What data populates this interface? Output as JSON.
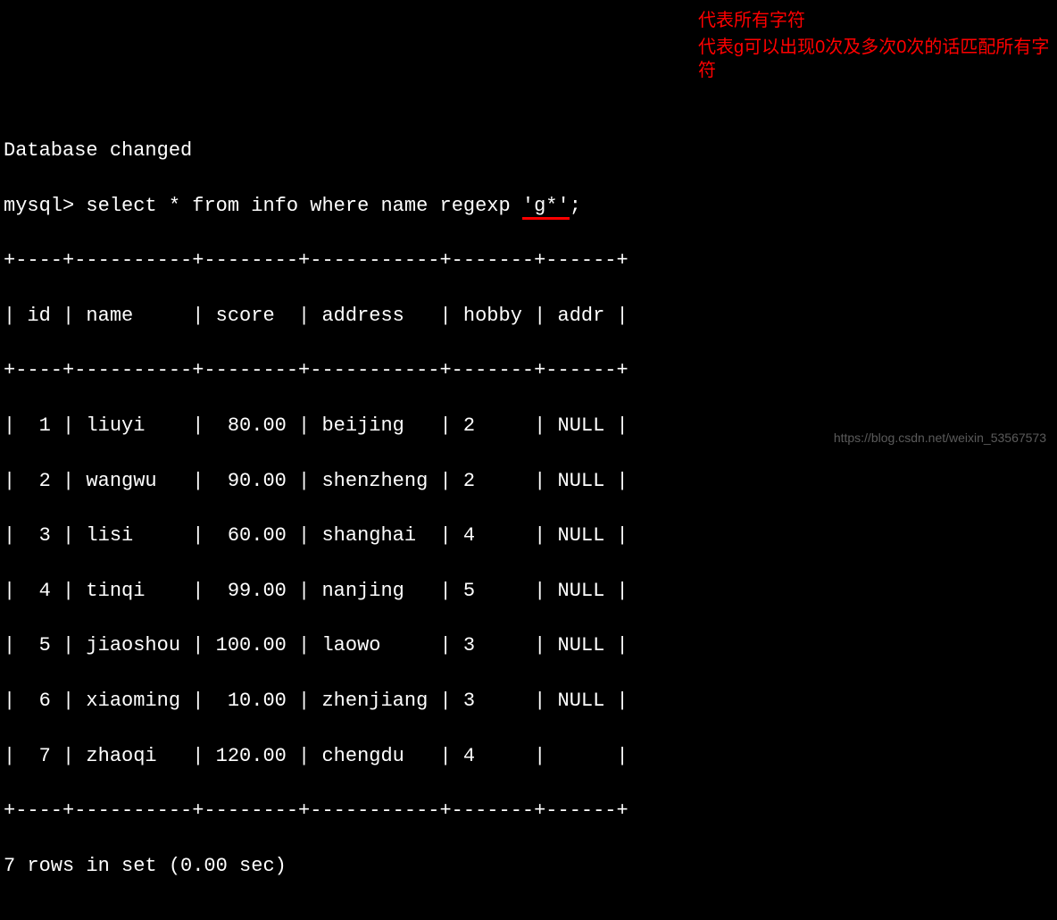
{
  "topline": "Database changed",
  "prompt": "mysql> ",
  "query_pre": "select * from info where name regexp ",
  "query_hl": "'g*'",
  "query_post": ";",
  "border_top": "+----+----------+--------+-----------+-------+------+",
  "header_row": "| id | name     | score  | address   | hobby | addr |",
  "border_mid": "+----+----------+--------+-----------+-------+------+",
  "rows": [
    "|  1 | liuyi    |  80.00 | beijing   | 2     | NULL |",
    "|  2 | wangwu   |  90.00 | shenzheng | 2     | NULL |",
    "|  3 | lisi     |  60.00 | shanghai  | 4     | NULL |",
    "|  4 | tinqi    |  99.00 | nanjing   | 5     | NULL |",
    "|  5 | jiaoshou | 100.00 | laowo     | 3     | NULL |",
    "|  6 | xiaoming |  10.00 | zhenjiang | 3     | NULL |",
    "|  7 | zhaoqi   | 120.00 | chengdu   | 4     |      |"
  ],
  "border_bot": "+----+----------+--------+-----------+-------+------+",
  "footer": "7 rows in set (0.00 sec)",
  "annotations": {
    "a1": "代表所有字符",
    "a2": "代表g可以出现0次及多次0次的话匹配所有字符"
  },
  "watermark": "https://blog.csdn.net/weixin_53567573",
  "chart_data": {
    "type": "table",
    "columns": [
      "id",
      "name",
      "score",
      "address",
      "hobby",
      "addr"
    ],
    "data": [
      {
        "id": 1,
        "name": "liuyi",
        "score": 80.0,
        "address": "beijing",
        "hobby": 2,
        "addr": "NULL"
      },
      {
        "id": 2,
        "name": "wangwu",
        "score": 90.0,
        "address": "shenzheng",
        "hobby": 2,
        "addr": "NULL"
      },
      {
        "id": 3,
        "name": "lisi",
        "score": 60.0,
        "address": "shanghai",
        "hobby": 4,
        "addr": "NULL"
      },
      {
        "id": 4,
        "name": "tinqi",
        "score": 99.0,
        "address": "nanjing",
        "hobby": 5,
        "addr": "NULL"
      },
      {
        "id": 5,
        "name": "jiaoshou",
        "score": 100.0,
        "address": "laowo",
        "hobby": 3,
        "addr": "NULL"
      },
      {
        "id": 6,
        "name": "xiaoming",
        "score": 10.0,
        "address": "zhenjiang",
        "hobby": 3,
        "addr": "NULL"
      },
      {
        "id": 7,
        "name": "zhaoqi",
        "score": 120.0,
        "address": "chengdu",
        "hobby": 4,
        "addr": ""
      }
    ]
  }
}
